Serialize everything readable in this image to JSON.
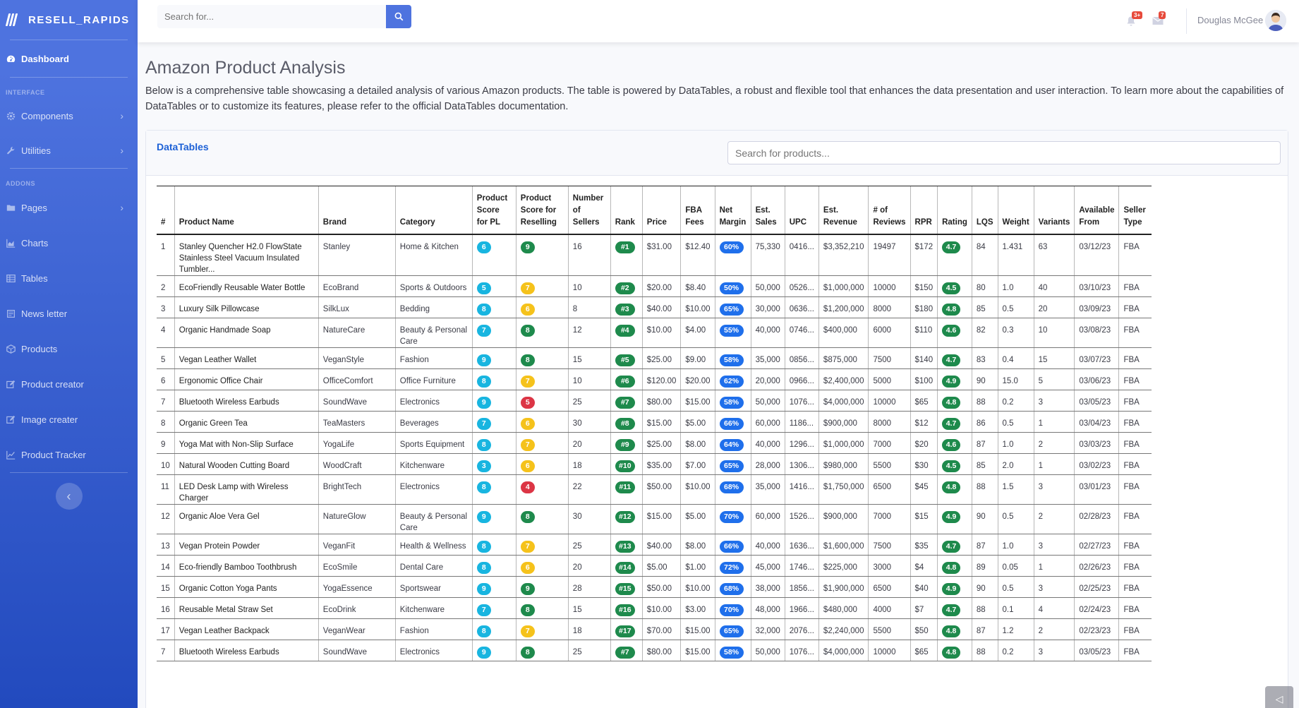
{
  "brand": {
    "name": "RESELL_RAPIDS"
  },
  "sidebar": {
    "dashboard": "Dashboard",
    "heading_interface": "INTERFACE",
    "components": "Components",
    "utilities": "Utilities",
    "heading_addons": "ADDONS",
    "pages": "Pages",
    "charts": "Charts",
    "tables": "Tables",
    "newsletter": "News letter",
    "products": "Products",
    "product_creator": "Product creator",
    "image_creater": "Image creater",
    "product_tracker": "Product Tracker"
  },
  "topbar": {
    "search_placeholder": "Search for...",
    "alerts_badge": "3+",
    "messages_badge": "7",
    "user_name": "Douglas McGee"
  },
  "page": {
    "title": "Amazon Product Analysis",
    "description": "Below is a comprehensive table showcasing a detailed analysis of various Amazon products. The table is powered by DataTables, a robust and flexible tool that enhances the data presentation and user interaction. To learn more about the capabilities of DataTables or to customize its features, please refer to the official DataTables documentation."
  },
  "card": {
    "title": "DataTables",
    "search_placeholder": "Search for products..."
  },
  "table": {
    "headers": [
      "#",
      "Product Name",
      "Brand",
      "Category",
      "Product Score for PL",
      "Product Score for Reselling",
      "Number of Sellers",
      "Rank",
      "Price",
      "FBA Fees",
      "Net Margin",
      "Est. Sales",
      "UPC",
      "Est. Revenue",
      "# of Reviews",
      "RPR",
      "Rating",
      "LQS",
      "Weight",
      "Variants",
      "Available From",
      "Seller Type"
    ],
    "rows": [
      [
        "1",
        "Stanley Quencher H2.0 FlowState Stainless Steel Vacuum Insulated Tumbler...",
        "Stanley",
        "Home & Kitchen",
        "6",
        "9",
        "16",
        "#1",
        "$31.00",
        "$12.40",
        "60%",
        "75,330",
        "0416...",
        "$3,352,210",
        "19497",
        "$172",
        "4.7",
        "84",
        "1.431",
        "63",
        "03/12/23",
        "FBA"
      ],
      [
        "2",
        "EcoFriendly Reusable Water Bottle",
        "EcoBrand",
        "Sports & Outdoors",
        "5",
        "7",
        "10",
        "#2",
        "$20.00",
        "$8.40",
        "50%",
        "50,000",
        "0526...",
        "$1,000,000",
        "10000",
        "$150",
        "4.5",
        "80",
        "1.0",
        "40",
        "03/10/23",
        "FBA"
      ],
      [
        "3",
        "Luxury Silk Pillowcase",
        "SilkLux",
        "Bedding",
        "8",
        "6",
        "8",
        "#3",
        "$40.00",
        "$10.00",
        "65%",
        "30,000",
        "0636...",
        "$1,200,000",
        "8000",
        "$180",
        "4.8",
        "85",
        "0.5",
        "20",
        "03/09/23",
        "FBA"
      ],
      [
        "4",
        "Organic Handmade Soap",
        "NatureCare",
        "Beauty & Personal Care",
        "7",
        "8",
        "12",
        "#4",
        "$10.00",
        "$4.00",
        "55%",
        "40,000",
        "0746...",
        "$400,000",
        "6000",
        "$110",
        "4.6",
        "82",
        "0.3",
        "10",
        "03/08/23",
        "FBA"
      ],
      [
        "5",
        "Vegan Leather Wallet",
        "VeganStyle",
        "Fashion",
        "9",
        "8",
        "15",
        "#5",
        "$25.00",
        "$9.00",
        "58%",
        "35,000",
        "0856...",
        "$875,000",
        "7500",
        "$140",
        "4.7",
        "83",
        "0.4",
        "15",
        "03/07/23",
        "FBA"
      ],
      [
        "6",
        "Ergonomic Office Chair",
        "OfficeComfort",
        "Office Furniture",
        "8",
        "7",
        "10",
        "#6",
        "$120.00",
        "$20.00",
        "62%",
        "20,000",
        "0966...",
        "$2,400,000",
        "5000",
        "$100",
        "4.9",
        "90",
        "15.0",
        "5",
        "03/06/23",
        "FBA"
      ],
      [
        "7",
        "Bluetooth Wireless Earbuds",
        "SoundWave",
        "Electronics",
        "9",
        "5",
        "25",
        "#7",
        "$80.00",
        "$15.00",
        "58%",
        "50,000",
        "1076...",
        "$4,000,000",
        "10000",
        "$65",
        "4.8",
        "88",
        "0.2",
        "3",
        "03/05/23",
        "FBA"
      ],
      [
        "8",
        "Organic Green Tea",
        "TeaMasters",
        "Beverages",
        "7",
        "6",
        "30",
        "#8",
        "$15.00",
        "$5.00",
        "66%",
        "60,000",
        "1186...",
        "$900,000",
        "8000",
        "$12",
        "4.7",
        "86",
        "0.5",
        "1",
        "03/04/23",
        "FBA"
      ],
      [
        "9",
        "Yoga Mat with Non-Slip Surface",
        "YogaLife",
        "Sports Equipment",
        "8",
        "7",
        "20",
        "#9",
        "$25.00",
        "$8.00",
        "64%",
        "40,000",
        "1296...",
        "$1,000,000",
        "7000",
        "$20",
        "4.6",
        "87",
        "1.0",
        "2",
        "03/03/23",
        "FBA"
      ],
      [
        "10",
        "Natural Wooden Cutting Board",
        "WoodCraft",
        "Kitchenware",
        "3",
        "6",
        "18",
        "#10",
        "$35.00",
        "$7.00",
        "65%",
        "28,000",
        "1306...",
        "$980,000",
        "5500",
        "$30",
        "4.5",
        "85",
        "2.0",
        "1",
        "03/02/23",
        "FBA"
      ],
      [
        "11",
        "LED Desk Lamp with Wireless Charger",
        "BrightTech",
        "Electronics",
        "8",
        "4",
        "22",
        "#11",
        "$50.00",
        "$10.00",
        "68%",
        "35,000",
        "1416...",
        "$1,750,000",
        "6500",
        "$45",
        "4.8",
        "88",
        "1.5",
        "3",
        "03/01/23",
        "FBA"
      ],
      [
        "12",
        "Organic Aloe Vera Gel",
        "NatureGlow",
        "Beauty & Personal Care",
        "9",
        "8",
        "30",
        "#12",
        "$15.00",
        "$5.00",
        "70%",
        "60,000",
        "1526...",
        "$900,000",
        "7000",
        "$15",
        "4.9",
        "90",
        "0.5",
        "2",
        "02/28/23",
        "FBA"
      ],
      [
        "13",
        "Vegan Protein Powder",
        "VeganFit",
        "Health & Wellness",
        "8",
        "7",
        "25",
        "#13",
        "$40.00",
        "$8.00",
        "66%",
        "40,000",
        "1636...",
        "$1,600,000",
        "7500",
        "$35",
        "4.7",
        "87",
        "1.0",
        "3",
        "02/27/23",
        "FBA"
      ],
      [
        "14",
        "Eco-friendly Bamboo Toothbrush",
        "EcoSmile",
        "Dental Care",
        "8",
        "6",
        "20",
        "#14",
        "$5.00",
        "$1.00",
        "72%",
        "45,000",
        "1746...",
        "$225,000",
        "3000",
        "$4",
        "4.8",
        "89",
        "0.05",
        "1",
        "02/26/23",
        "FBA"
      ],
      [
        "15",
        "Organic Cotton Yoga Pants",
        "YogaEssence",
        "Sportswear",
        "9",
        "9",
        "28",
        "#15",
        "$50.00",
        "$10.00",
        "68%",
        "38,000",
        "1856...",
        "$1,900,000",
        "6500",
        "$40",
        "4.9",
        "90",
        "0.5",
        "3",
        "02/25/23",
        "FBA"
      ],
      [
        "16",
        "Reusable Metal Straw Set",
        "EcoDrink",
        "Kitchenware",
        "7",
        "8",
        "15",
        "#16",
        "$10.00",
        "$3.00",
        "70%",
        "48,000",
        "1966...",
        "$480,000",
        "4000",
        "$7",
        "4.7",
        "88",
        "0.1",
        "4",
        "02/24/23",
        "FBA"
      ],
      [
        "17",
        "Vegan Leather Backpack",
        "VeganWear",
        "Fashion",
        "8",
        "7",
        "18",
        "#17",
        "$70.00",
        "$15.00",
        "65%",
        "32,000",
        "2076...",
        "$2,240,000",
        "5500",
        "$50",
        "4.8",
        "87",
        "1.2",
        "2",
        "02/23/23",
        "FBA"
      ],
      [
        "7",
        "Bluetooth Wireless Earbuds",
        "SoundWave",
        "Electronics",
        "9",
        "8",
        "25",
        "#7",
        "$80.00",
        "$15.00",
        "58%",
        "50,000",
        "1076...",
        "$4,000,000",
        "10000",
        "$65",
        "4.8",
        "88",
        "0.2",
        "3",
        "03/05/23",
        "FBA"
      ]
    ],
    "reselling_colors": {
      "9": "green",
      "8": "green",
      "7": "yellow",
      "6": "yellow",
      "5": "red",
      "4": "red"
    }
  },
  "colors": {
    "primary": "#4e73df",
    "rank_green": "#1e8a4c",
    "pl_cyan": "#18b5e0",
    "margin_blue": "#1f6feb",
    "warn_yellow": "#f5c21b",
    "danger_red": "#dc3545"
  }
}
